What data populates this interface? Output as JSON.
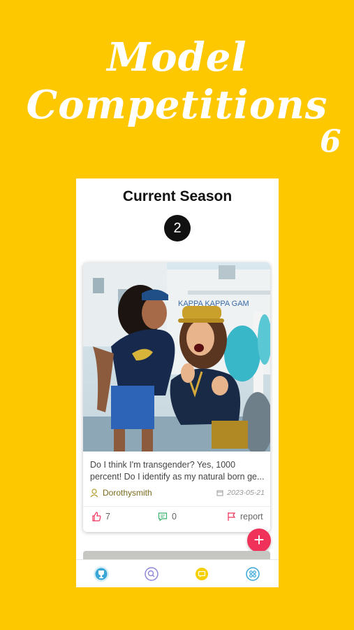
{
  "hero": {
    "line1": "Model",
    "line2": "Competitions",
    "edge_glyph": "6"
  },
  "screen": {
    "title": "Current Season",
    "season_number": "2",
    "post": {
      "text": "Do I think I'm transgender? Yes, 1000 percent! Do I identify as my natural born ge...",
      "author": "Dorothysmith",
      "date": "2023-05-21",
      "likes": "7",
      "comments": "0",
      "report_label": "report"
    },
    "fab_label": "+",
    "nav": {
      "items": [
        {
          "icon": "trophy-icon",
          "active": true
        },
        {
          "icon": "search-icon",
          "active": false
        },
        {
          "icon": "chat-icon",
          "active": false
        },
        {
          "icon": "apps-icon",
          "active": false
        }
      ]
    }
  },
  "colors": {
    "background": "#FEC800",
    "accent": "#F0315A",
    "nav_active": "#3AA6D8",
    "nav_chat": "#F5D000",
    "meta_text": "#7a6a1c"
  }
}
